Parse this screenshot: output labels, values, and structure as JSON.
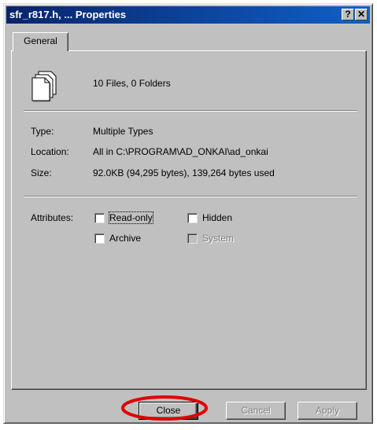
{
  "window": {
    "title": "sfr_r817.h, ... Properties",
    "help_button": "?",
    "close_button": "✕"
  },
  "tabs": [
    {
      "label": "General"
    }
  ],
  "summary": {
    "text": "10 Files, 0 Folders",
    "icon": "multiple-files-icon"
  },
  "info": {
    "type_label": "Type:",
    "type_value": "Multiple Types",
    "location_label": "Location:",
    "location_value": "All in C:\\PROGRAM\\AD_ONKAI\\ad_onkai",
    "size_label": "Size:",
    "size_value": "92.0KB (94,295 bytes), 139,264 bytes used"
  },
  "attributes": {
    "label": "Attributes:",
    "read_only": {
      "label": "Read-only",
      "checked": false
    },
    "hidden": {
      "label": "Hidden",
      "checked": false
    },
    "archive": {
      "label": "Archive",
      "checked": false
    },
    "system": {
      "label": "System",
      "checked": false,
      "disabled": true
    }
  },
  "buttons": {
    "close": "Close",
    "cancel": "Cancel",
    "apply": "Apply"
  },
  "highlight_color": "#e00000"
}
